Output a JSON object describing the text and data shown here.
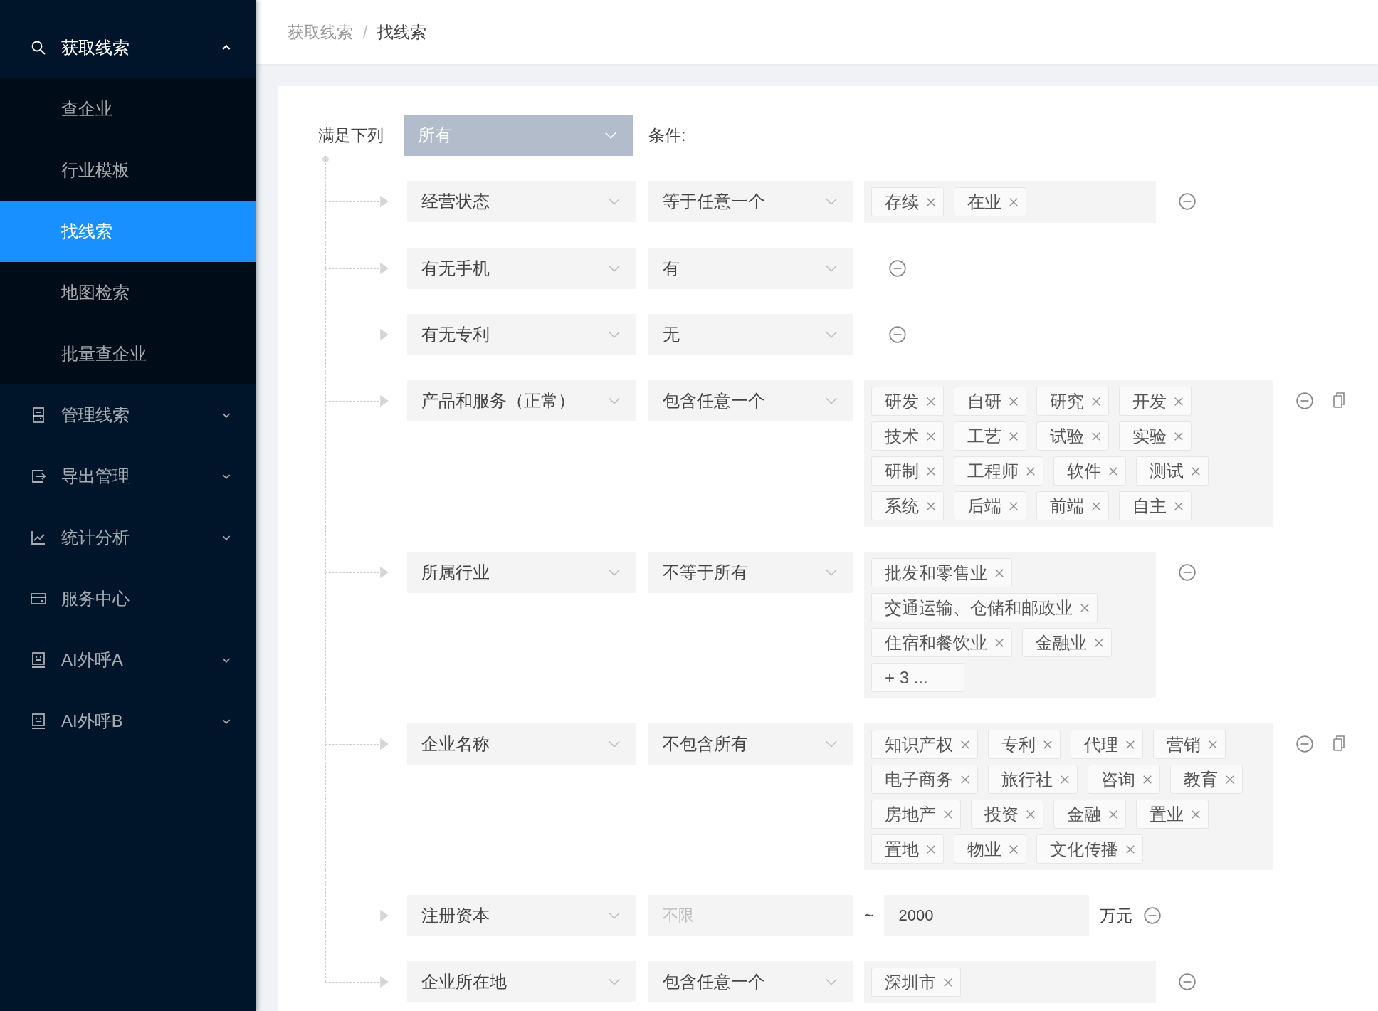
{
  "sidebar": {
    "items": [
      {
        "label": "获取线索",
        "kind": "submenu",
        "expanded": true,
        "children": [
          {
            "label": "查企业",
            "selected": false
          },
          {
            "label": "行业模板",
            "selected": false
          },
          {
            "label": "找线索",
            "selected": true
          },
          {
            "label": "地图检索",
            "selected": false
          },
          {
            "label": "批量查企业",
            "selected": false
          }
        ]
      },
      {
        "label": "管理线索",
        "kind": "submenu",
        "expanded": false
      },
      {
        "label": "导出管理",
        "kind": "submenu",
        "expanded": false
      },
      {
        "label": "统计分析",
        "kind": "submenu",
        "expanded": false
      },
      {
        "label": "服务中心",
        "kind": "link",
        "expanded": false
      },
      {
        "label": "AI外呼A",
        "kind": "submenu",
        "expanded": false
      },
      {
        "label": "AI外呼B",
        "kind": "submenu",
        "expanded": false
      }
    ]
  },
  "breadcrumb": {
    "items": [
      "获取线索",
      "找线索"
    ],
    "separator": "/"
  },
  "match": {
    "label": "满足下列",
    "value": "所有",
    "suffix": "条件:"
  },
  "conditions": [
    {
      "field": "经营状态",
      "operator": "等于任意一个",
      "kind": "tags",
      "copyable": false,
      "tags": [
        "存续",
        "在业"
      ]
    },
    {
      "field": "有无手机",
      "operator": "有",
      "kind": "none",
      "copyable": false
    },
    {
      "field": "有无专利",
      "operator": "无",
      "kind": "none",
      "copyable": false
    },
    {
      "field": "产品和服务（正常）",
      "operator": "包含任意一个",
      "kind": "tags",
      "copyable": true,
      "tags": [
        "研发",
        "自研",
        "研究",
        "开发",
        "技术",
        "工艺",
        "试验",
        "实验",
        "研制",
        "工程师",
        "软件",
        "测试",
        "系统",
        "后端",
        "前端",
        "自主"
      ]
    },
    {
      "field": "所属行业",
      "operator": "不等于所有",
      "kind": "tags",
      "copyable": false,
      "tags": [
        "批发和零售业",
        "交通运输、仓储和邮政业",
        "住宿和餐饮业",
        "金融业"
      ],
      "more": "+ 3 ..."
    },
    {
      "field": "企业名称",
      "operator": "不包含所有",
      "kind": "tags",
      "copyable": true,
      "tags": [
        "知识产权",
        "专利",
        "代理",
        "营销",
        "电子商务",
        "旅行社",
        "咨询",
        "教育",
        "房地产",
        "投资",
        "金融",
        "置业",
        "置地",
        "物业",
        "文化传播"
      ]
    },
    {
      "field": "注册资本",
      "kind": "range",
      "copyable": false,
      "min_placeholder": "不限",
      "separator": "~",
      "max_value": "2000",
      "unit": "万元"
    },
    {
      "field": "企业所在地",
      "operator": "包含任意一个",
      "kind": "tags",
      "copyable": false,
      "tags": [
        "深圳市"
      ]
    }
  ]
}
